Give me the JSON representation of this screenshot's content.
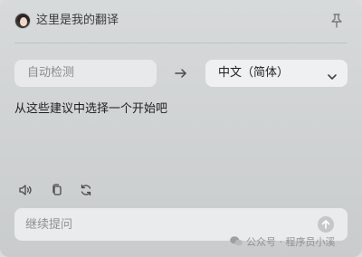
{
  "header": {
    "title": "这里是我的翻译",
    "avatar_icon": "avatar-icon",
    "pin_icon": "pin-icon"
  },
  "languages": {
    "source": "自动检测",
    "swap_icon": "arrow-right-icon",
    "target": "中文（简体）",
    "target_icon": "chevron-down-icon"
  },
  "suggestion": {
    "text": "从这些建议中选择一个开始吧"
  },
  "toolbar": {
    "items": [
      {
        "icon": "speaker-icon"
      },
      {
        "icon": "copy-icon"
      },
      {
        "icon": "refresh-icon"
      }
    ]
  },
  "input": {
    "placeholder": "继续提问",
    "send_icon": "send-arrow-up-icon"
  },
  "watermark": {
    "text": "公众号 · 程序员小溪"
  },
  "colors": {
    "background": "#d2d5d6",
    "field": "#e9ebec",
    "text": "#1e1e1e",
    "muted": "#8a8c8d"
  }
}
